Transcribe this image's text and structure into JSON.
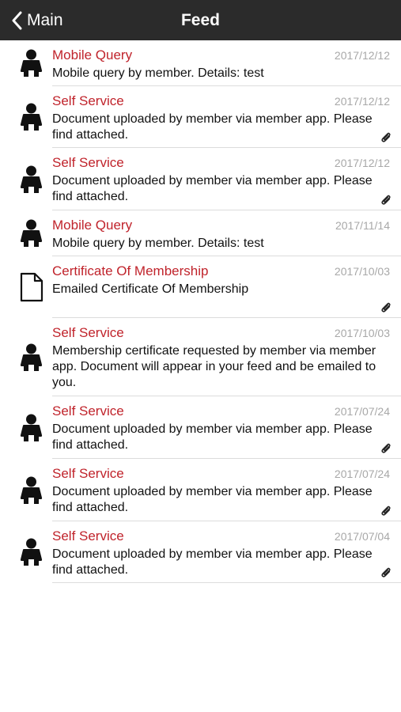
{
  "navbar": {
    "back_label": "Main",
    "title": "Feed"
  },
  "colors": {
    "navbar_bg": "#2b2b2b",
    "title_red": "#c0232b",
    "date_gray": "#a8a8a8"
  },
  "items": [
    {
      "title": "Mobile Query",
      "date": "2017/12/12",
      "description": "Mobile query by member.  Details: test",
      "icon": "person-icon",
      "attachment": false
    },
    {
      "title": "Self Service",
      "date": "2017/12/12",
      "description": "Document uploaded by member via member app. Please find attached.",
      "icon": "person-icon",
      "attachment": true
    },
    {
      "title": "Self Service",
      "date": "2017/12/12",
      "description": "Document uploaded by member via member app. Please find attached.",
      "icon": "person-icon",
      "attachment": true
    },
    {
      "title": "Mobile Query",
      "date": "2017/11/14",
      "description": "Mobile query by member.  Details: test",
      "icon": "person-icon",
      "attachment": false
    },
    {
      "title": "Certificate Of Membership",
      "date": "2017/10/03",
      "description": "Emailed Certificate Of Membership",
      "icon": "document-icon",
      "attachment": true
    },
    {
      "title": "Self Service",
      "date": "2017/10/03",
      "description": "Membership certificate requested by member via member app. Document will appear in your feed and be emailed to you.",
      "icon": "person-icon",
      "attachment": false
    },
    {
      "title": "Self Service",
      "date": "2017/07/24",
      "description": "Document uploaded by member via member app. Please find attached.",
      "icon": "person-icon",
      "attachment": true
    },
    {
      "title": "Self Service",
      "date": "2017/07/24",
      "description": "Document uploaded by member via member app. Please find attached.",
      "icon": "person-icon",
      "attachment": true
    },
    {
      "title": "Self Service",
      "date": "2017/07/04",
      "description": "Document uploaded by member via member app. Please find attached.",
      "icon": "person-icon",
      "attachment": true
    }
  ]
}
